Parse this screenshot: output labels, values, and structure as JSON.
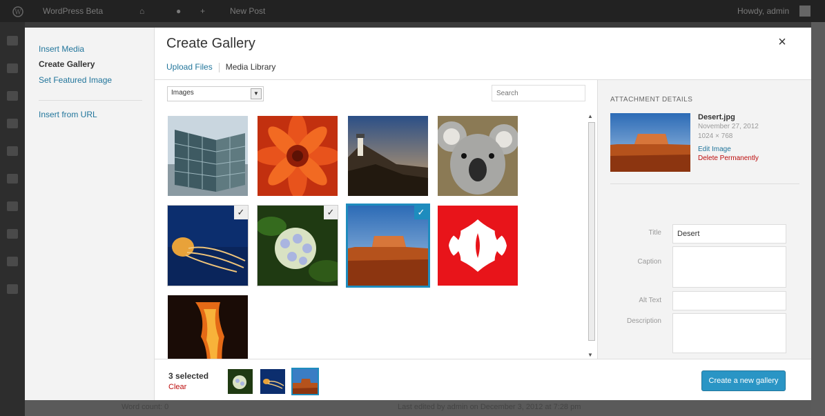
{
  "admin_bar": {
    "site_name": "WordPress Beta",
    "new_post": "New Post",
    "howdy": "Howdy, admin"
  },
  "menu": {
    "insert_media": "Insert Media",
    "create_gallery": "Create Gallery",
    "set_featured_image": "Set Featured Image",
    "insert_from_url": "Insert from URL"
  },
  "header": {
    "title": "Create Gallery",
    "close_icon": "×",
    "tabs": [
      "Upload Files",
      "Media Library"
    ]
  },
  "filter": {
    "value": "Images",
    "arrow": "▼",
    "search_placeholder": "Search"
  },
  "grid": {
    "items": [
      {
        "name": "building",
        "selected": false,
        "current": false
      },
      {
        "name": "flower-red",
        "selected": false,
        "current": false
      },
      {
        "name": "lighthouse",
        "selected": false,
        "current": false
      },
      {
        "name": "koala",
        "selected": false,
        "current": false
      },
      {
        "name": "jellyfish",
        "selected": true,
        "current": false
      },
      {
        "name": "hydrangea",
        "selected": true,
        "current": false
      },
      {
        "name": "desert",
        "selected": true,
        "current": true
      },
      {
        "name": "tulips",
        "selected": false,
        "current": false
      },
      {
        "name": "lava",
        "selected": false,
        "current": false
      }
    ],
    "check_glyph": "✓"
  },
  "details": {
    "heading": "ATTACHMENT DETAILS",
    "filename": "Desert.jpg",
    "date": "November 27, 2012",
    "dimensions": "1024 × 768",
    "edit_image": "Edit Image",
    "delete_permanently": "Delete Permanently",
    "fields": {
      "title_label": "Title",
      "title_value": "Desert",
      "caption_label": "Caption",
      "alt_label": "Alt Text",
      "description_label": "Description"
    }
  },
  "toolbar": {
    "selected_count": "3 selected",
    "clear": "Clear",
    "button": "Create a new gallery"
  },
  "background": {
    "bottom_left": "Word count: 0",
    "bottom_mid": "Last edited by admin on December 3, 2012 at 7:28 pm"
  },
  "colors": {
    "accent": "#1e8cbe",
    "link": "#21759b",
    "danger": "#bc0b0b",
    "button": "#2a95c5"
  }
}
